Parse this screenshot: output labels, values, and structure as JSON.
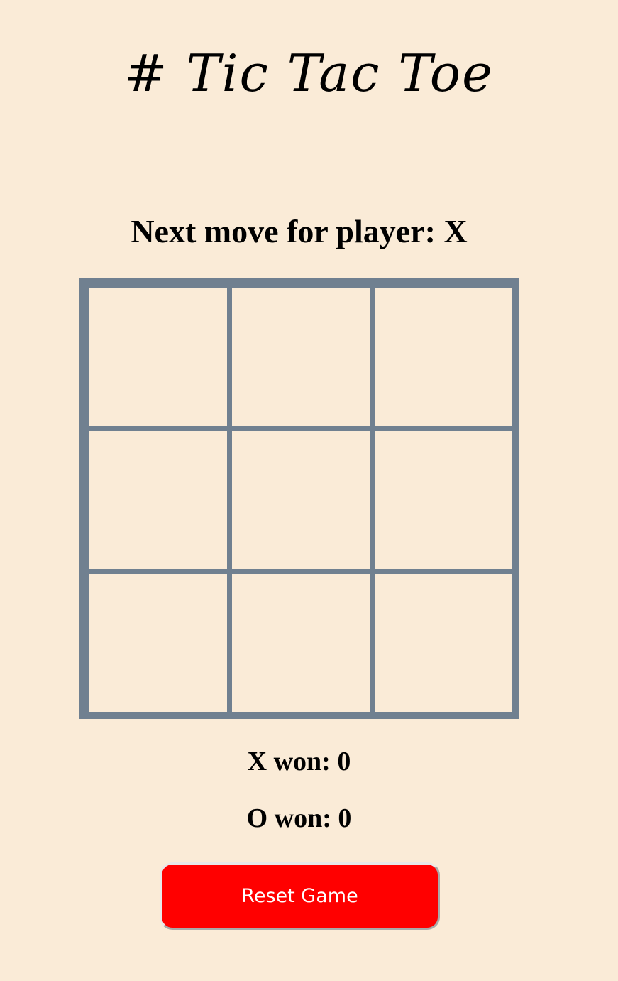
{
  "app": {
    "title": "# Tic Tac Toe"
  },
  "status": {
    "text": "Next move for player: X"
  },
  "board": {
    "cells": [
      "",
      "",
      "",
      "",
      "",
      "",
      "",
      "",
      ""
    ]
  },
  "scores": {
    "x_label": "X won: 0",
    "o_label": "O won: 0"
  },
  "controls": {
    "reset_label": "Reset Game"
  },
  "colors": {
    "background": "#faebd7",
    "grid": "#708090",
    "reset_button": "#ff0000",
    "reset_text": "#ffffff"
  }
}
